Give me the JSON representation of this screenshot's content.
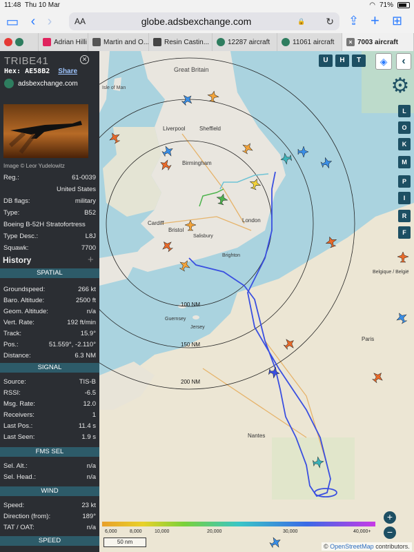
{
  "status_bar": {
    "time": "11:48",
    "date": "Thu 10 Mar",
    "battery": "71%"
  },
  "browser": {
    "aa_label": "AA",
    "url": "globe.adsbexchange.com"
  },
  "tabs": [
    {
      "label": "Adrian Hilli",
      "color": "#e0245e"
    },
    {
      "label": "Martin and O...",
      "color": "#555555"
    },
    {
      "label": "Resin Castin...",
      "color": "#444444"
    },
    {
      "label": "12287 aircraft",
      "color": "#2e7d5f"
    },
    {
      "label": "11061 aircraft",
      "color": "#2e7d5f"
    },
    {
      "label": "7003 aircraft",
      "color": "#777777"
    }
  ],
  "aircraft": {
    "callsign": "TRIBE41",
    "hex_label": "Hex:",
    "hex": "AE58B2",
    "share_label": "Share",
    "link_text": "adsbexchange.com",
    "photo_credit": "Image © Leor Yudelowitz"
  },
  "info_rows": [
    {
      "label": "Reg.:",
      "value": "61-0039"
    },
    {
      "label": "",
      "value": "United States"
    },
    {
      "label": "DB flags:",
      "value": "military"
    },
    {
      "label": "Type:",
      "value": "B52"
    },
    {
      "label": "Boeing B-52H Stratofortress",
      "value": ""
    },
    {
      "label": "Type Desc.:",
      "value": "L8J"
    },
    {
      "label": "Squawk:",
      "value": "7700"
    }
  ],
  "history_label": "History",
  "sections": {
    "spatial": "SPATIAL",
    "signal": "SIGNAL",
    "fms": "FMS SEL",
    "wind": "WIND",
    "speed": "SPEED"
  },
  "spatial_rows": [
    {
      "label": "Groundspeed:",
      "value": "266 kt"
    },
    {
      "label": "Baro. Altitude:",
      "value": "2500 ft"
    },
    {
      "label": "Geom. Altitude:",
      "value": "n/a"
    },
    {
      "label": "Vert. Rate:",
      "value": "192 ft/min"
    },
    {
      "label": "Track:",
      "value": "15.9°"
    },
    {
      "label": "Pos.:",
      "value": "51.559°, -2.110°"
    },
    {
      "label": "Distance:",
      "value": "6.3 NM"
    }
  ],
  "signal_rows": [
    {
      "label": "Source:",
      "value": "TIS-B"
    },
    {
      "label": "RSSI:",
      "value": "-6.5"
    },
    {
      "label": "Msg. Rate:",
      "value": "12.0"
    },
    {
      "label": "Receivers:",
      "value": "1"
    },
    {
      "label": "Last Pos.:",
      "value": "11.4 s"
    },
    {
      "label": "Last Seen:",
      "value": "1.9 s"
    }
  ],
  "fms_rows": [
    {
      "label": "Sel. Alt.:",
      "value": "n/a"
    },
    {
      "label": "Sel. Head.:",
      "value": "n/a"
    }
  ],
  "wind_rows": [
    {
      "label": "Speed:",
      "value": "23 kt"
    },
    {
      "label": "Direction (from):",
      "value": "189°"
    },
    {
      "label": "TAT / OAT:",
      "value": "n/a"
    }
  ],
  "map": {
    "top_buttons": [
      "U",
      "H",
      "T"
    ],
    "side_buttons": [
      "L",
      "O",
      "K",
      "M",
      "P",
      "I",
      "R",
      "F"
    ],
    "range_labels": [
      "100 NM",
      "150 NM",
      "200 NM"
    ],
    "place_labels": [
      "Great Britain",
      "Isle of Man",
      "Liverpool",
      "Sheffield",
      "Birmingham",
      "Cardiff",
      "Bristol",
      "London",
      "Salisbury",
      "Brighton",
      "Guernsey",
      "Jersey",
      "Nantes",
      "Belgique / België",
      "Paris"
    ],
    "scale_label": "50 nm",
    "altitude_ticks": [
      "6,000",
      "8,000",
      "10,000",
      "20,000",
      "30,000",
      "40,000+"
    ],
    "attribution_prefix": "©",
    "attribution_link": "OpenStreetMap",
    "attribution_suffix": "contributors."
  },
  "colors": {
    "track": "#3a4fe0",
    "panel": "#2b2e33",
    "section": "#2d5b69",
    "button": "#1d4f63"
  }
}
